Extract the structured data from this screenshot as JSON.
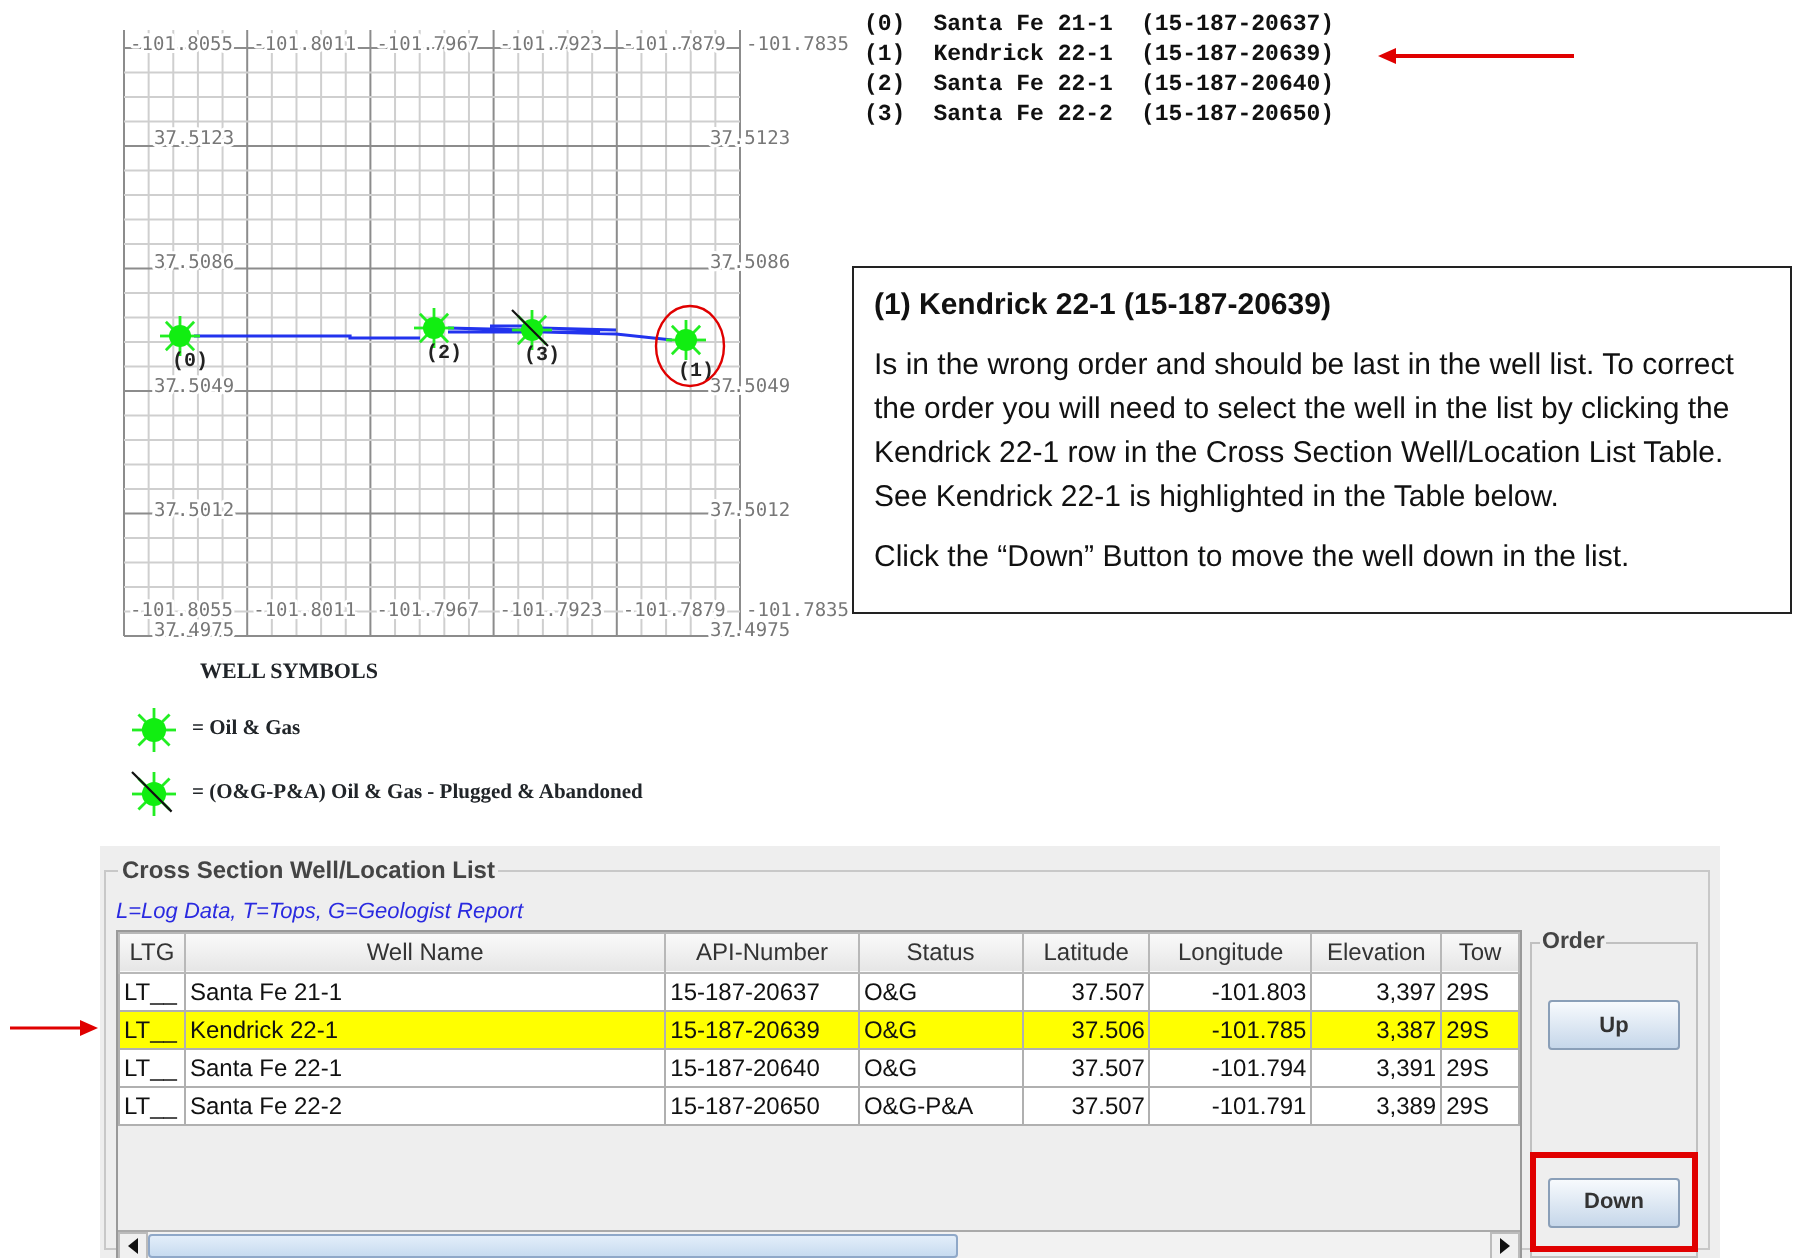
{
  "map": {
    "top_labels": [
      "-101.8055",
      "-101.8011",
      "-101.7967",
      "-101.7923",
      "-101.7879",
      "-101.7835"
    ],
    "bottom_labels": [
      "-101.8055",
      "-101.8011",
      "-101.7967",
      "-101.7923",
      "-101.7879",
      "-101.7835"
    ],
    "left_labels": [
      "37.5123",
      "37.5086",
      "37.5049",
      "37.5012",
      "37.4975"
    ],
    "right_labels": [
      "37.5123",
      "37.5086",
      "37.5049",
      "37.5012",
      "37.4975"
    ],
    "wells": [
      {
        "label": "(0)",
        "kind": "oil-gas",
        "circled": false
      },
      {
        "label": "(1)",
        "kind": "oil-gas",
        "circled": true
      },
      {
        "label": "(2)",
        "kind": "oil-gas",
        "circled": false
      },
      {
        "label": "(3)",
        "kind": "plugged-abandoned",
        "circled": false
      }
    ]
  },
  "well_list": [
    {
      "index": "(0)",
      "name": "Santa Fe 21-1",
      "api": "(15-187-20637)",
      "arrow": false
    },
    {
      "index": "(1)",
      "name": "Kendrick 22-1",
      "api": "(15-187-20639)",
      "arrow": true
    },
    {
      "index": "(2)",
      "name": "Santa Fe 22-1",
      "api": "(15-187-20640)",
      "arrow": false
    },
    {
      "index": "(3)",
      "name": "Santa Fe 22-2",
      "api": "(15-187-20650)",
      "arrow": false
    }
  ],
  "callout": {
    "title": "(1) Kendrick 22-1 (15-187-20639)",
    "paragraphs": [
      "Is in the wrong order and should be last in the well list.  To correct the order you will need to select  the well in the list by clicking the Kendrick 22-1 row  in the Cross Section Well/Location List Table. See Kendrick 22-1 is highlighted in the Table below.",
      "Click the “Down” Button to move the well down in the list."
    ]
  },
  "legend": {
    "title": "WELL SYMBOLS",
    "items": [
      {
        "kind": "oil-gas",
        "text": "= Oil & Gas"
      },
      {
        "kind": "plugged-abandoned",
        "text": "= (O&G-P&A) Oil & Gas - Plugged & Abandoned"
      }
    ]
  },
  "panel": {
    "title": "Cross Section Well/Location List",
    "note": "L=Log Data, T=Tops, G=Geologist Report",
    "columns": [
      "LTG",
      "Well Name",
      "API-Number",
      "Status",
      "Latitude",
      "Longitude",
      "Elevation",
      "Tow"
    ],
    "rows": [
      {
        "cells": [
          "LT__",
          "Santa Fe 21-1",
          "15-187-20637",
          "O&G",
          "37.507",
          "-101.803",
          "3,397",
          "29S"
        ],
        "selected": false,
        "arrow": false
      },
      {
        "cells": [
          "LT__",
          "Kendrick 22-1",
          "15-187-20639",
          "O&G",
          "37.506",
          "-101.785",
          "3,387",
          "29S"
        ],
        "selected": true,
        "arrow": true
      },
      {
        "cells": [
          "LT__",
          "Santa Fe 22-1",
          "15-187-20640",
          "O&G",
          "37.507",
          "-101.794",
          "3,391",
          "29S"
        ],
        "selected": false,
        "arrow": false
      },
      {
        "cells": [
          "LT__",
          "Santa Fe 22-2",
          "15-187-20650",
          "O&G-P&A",
          "37.507",
          "-101.791",
          "3,389",
          "29S"
        ],
        "selected": false,
        "arrow": false
      }
    ],
    "order": {
      "title": "Order",
      "buttons": [
        {
          "label": "Up",
          "highlighted": false
        },
        {
          "label": "Down",
          "highlighted": true
        }
      ]
    }
  }
}
